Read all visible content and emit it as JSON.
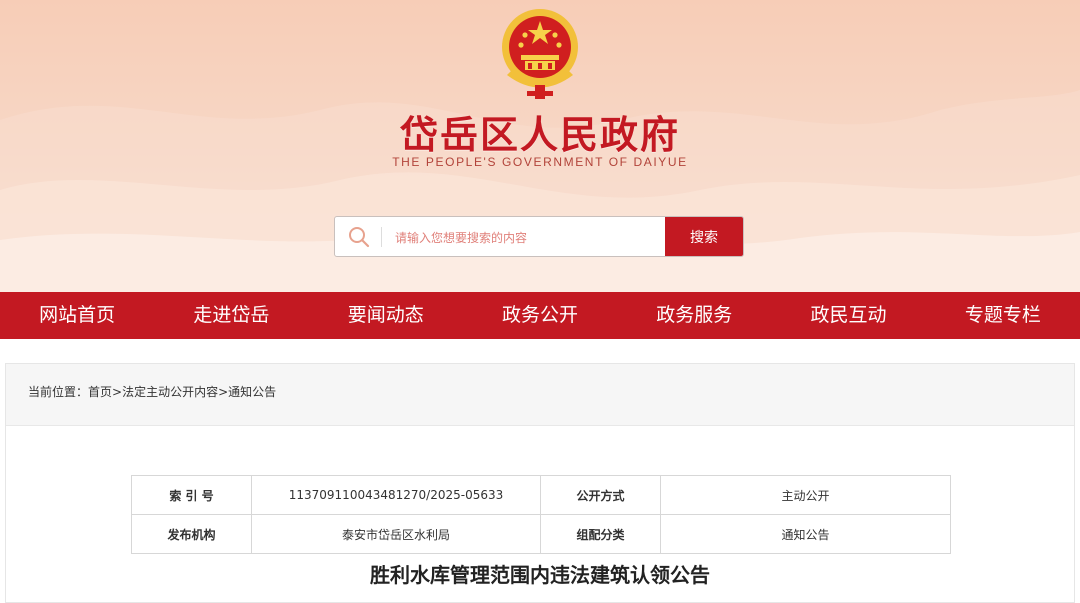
{
  "header": {
    "title": "岱岳区人民政府",
    "subtitle": "THE PEOPLE'S GOVERNMENT OF DAIYUE",
    "emblem_icon": "national-emblem-icon"
  },
  "search": {
    "placeholder": "请输入您想要搜索的内容",
    "button_label": "搜索",
    "icon": "search-icon"
  },
  "nav": {
    "items": [
      {
        "label": "网站首页"
      },
      {
        "label": "走进岱岳"
      },
      {
        "label": "要闻动态"
      },
      {
        "label": "政务公开"
      },
      {
        "label": "政务服务"
      },
      {
        "label": "政民互动"
      },
      {
        "label": "专题专栏"
      }
    ]
  },
  "breadcrumb": {
    "prefix": "当前位置：",
    "items": [
      "首页",
      "法定主动公开内容",
      "通知公告"
    ],
    "separator": ">"
  },
  "info_table": {
    "rows": [
      [
        {
          "label": "索 引 号",
          "value": "113709110043481270/2025-05633"
        },
        {
          "label": "公开方式",
          "value": "主动公开"
        }
      ],
      [
        {
          "label": "发布机构",
          "value": "泰安市岱岳区水利局"
        },
        {
          "label": "组配分类",
          "value": "通知公告"
        }
      ]
    ]
  },
  "article": {
    "title": "胜利水库管理范围内违法建筑认领公告"
  },
  "colors": {
    "primary_red": "#c31922",
    "header_bg": "#f7cdb7",
    "emblem_gold": "#f2c03a"
  }
}
